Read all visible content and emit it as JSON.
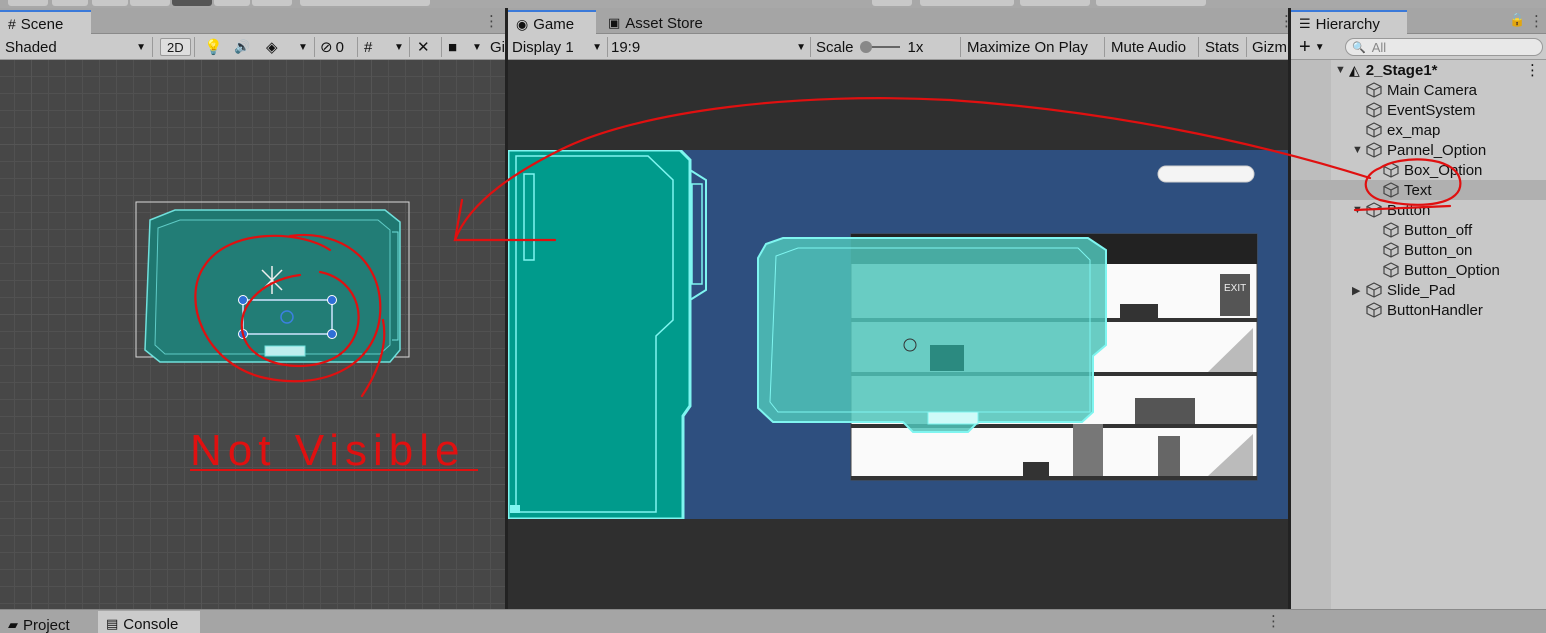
{
  "scene_panel": {
    "tab_label": "Scene",
    "shading_mode": "Shaded",
    "mode_2d_label": "2D",
    "hidden_count": "0",
    "gizmos_label": "Gi"
  },
  "game_panel": {
    "tab_label": "Game",
    "asset_tab_label": "Asset Store",
    "display": "Display 1",
    "aspect": "19:9",
    "scale_label": "Scale",
    "scale_value": "1x",
    "maximize_label": "Maximize On Play",
    "mute_label": "Mute Audio",
    "stats_label": "Stats",
    "gizmos_label": "Gizm",
    "exit_sign": "EXIT"
  },
  "hierarchy": {
    "tab_label": "Hierarchy",
    "search_placeholder": "All",
    "scene_name": "2_Stage1*",
    "items": [
      {
        "label": "Main Camera",
        "depth": 1
      },
      {
        "label": "EventSystem",
        "depth": 1
      },
      {
        "label": "ex_map",
        "depth": 1
      },
      {
        "label": "Pannel_Option",
        "depth": 1,
        "expanded": true
      },
      {
        "label": "Box_Option",
        "depth": 2
      },
      {
        "label": "Text",
        "depth": 2,
        "selected": true
      },
      {
        "label": "Button",
        "depth": 1,
        "expanded": true
      },
      {
        "label": "Button_off",
        "depth": 2
      },
      {
        "label": "Button_on",
        "depth": 2
      },
      {
        "label": "Button_Option",
        "depth": 2
      },
      {
        "label": "Slide_Pad",
        "depth": 1,
        "expanded": false
      },
      {
        "label": "ButtonHandler",
        "depth": 1
      }
    ]
  },
  "bottom": {
    "project_tab": "Project",
    "console_tab": "Console"
  },
  "annotation": {
    "text": "Not Visible",
    "color": "#e01010"
  },
  "colors": {
    "accent_tab": "#3a79d9",
    "panel_teal": "#009b8c",
    "panel_outline": "#7ff5f0",
    "game_bg": "#2e4f7f"
  }
}
